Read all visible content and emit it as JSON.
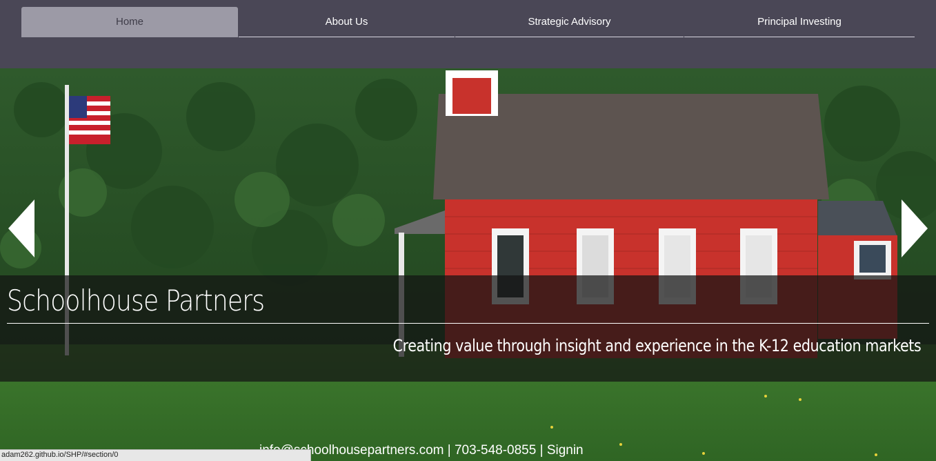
{
  "nav": {
    "items": [
      {
        "label": "Home",
        "active": true
      },
      {
        "label": "About Us",
        "active": false
      },
      {
        "label": "Strategic Advisory",
        "active": false
      },
      {
        "label": "Principal Investing",
        "active": false
      }
    ]
  },
  "hero": {
    "title": "Schoolhouse Partners",
    "subtitle": "Creating value through insight and experience in the K-12 education markets",
    "prev_icon": "chevron-left-icon",
    "next_icon": "chevron-right-icon"
  },
  "footer": {
    "email": "info@schoolhousepartners.com",
    "phone": "703-548-0855",
    "signin": "Signin",
    "separator": "|"
  },
  "status_bar": {
    "url": "adam262.github.io/SHP/#section/0"
  },
  "colors": {
    "nav_bg": "#4a4756",
    "nav_active": "#9c9aa6",
    "caption_bg": "#141414"
  }
}
